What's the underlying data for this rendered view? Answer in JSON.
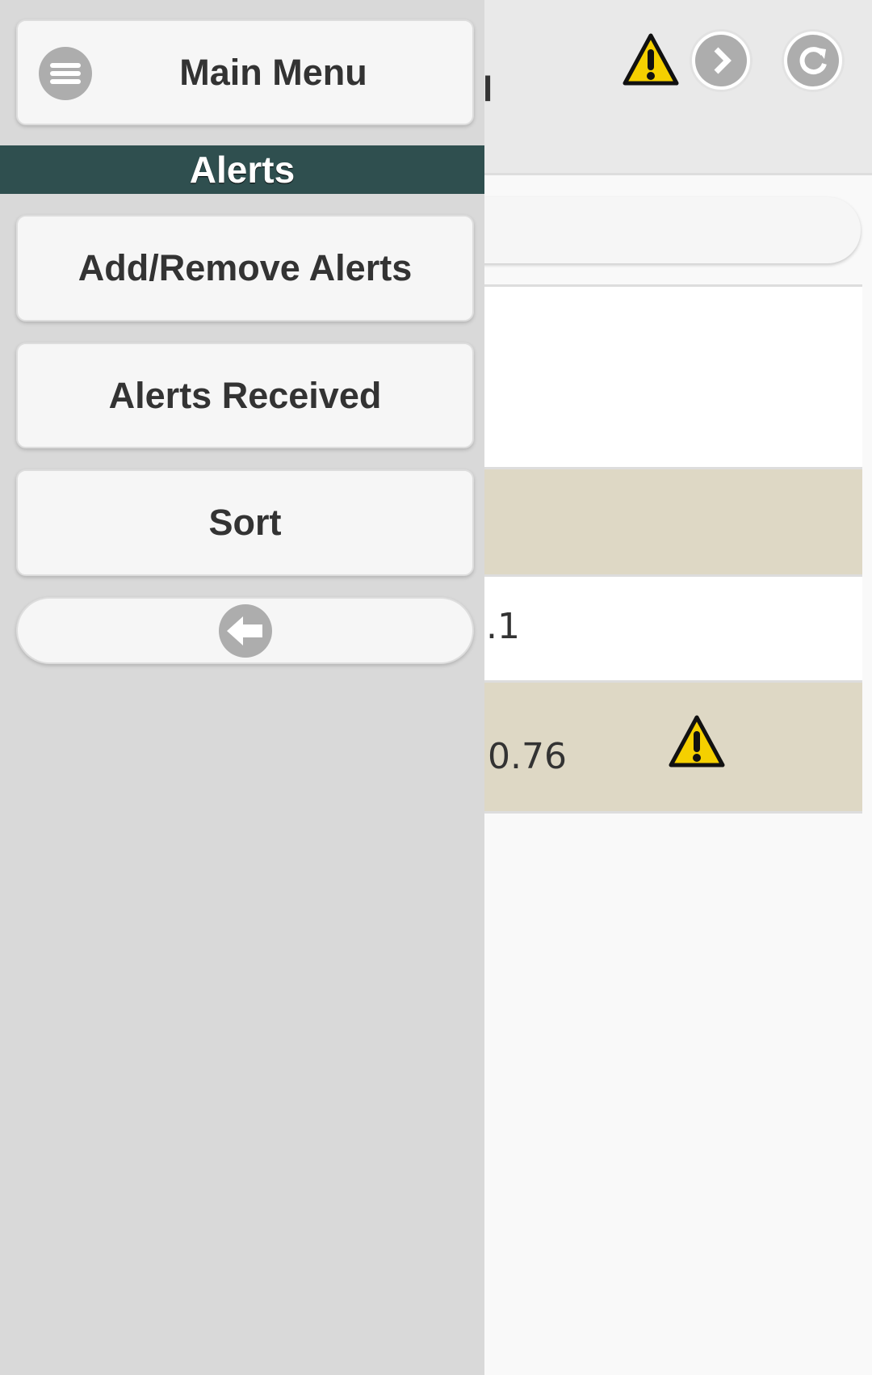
{
  "header": {
    "title_fragment": "l",
    "icons": [
      "warning-icon",
      "forward-icon",
      "refresh-icon"
    ]
  },
  "list": {
    "rows": [
      {
        "value": ""
      },
      {
        "value": ""
      },
      {
        "value": ".1"
      },
      {
        "value": "0.76",
        "icon": "warning-icon"
      }
    ]
  },
  "panel": {
    "main_menu_label": "Main Menu",
    "section_title": "Alerts",
    "items": [
      {
        "label": "Add/Remove Alerts"
      },
      {
        "label": "Alerts Received"
      },
      {
        "label": "Sort"
      }
    ],
    "back_icon": "arrow-left-icon"
  },
  "colors": {
    "section_bar": "#2f4f4f",
    "alt_row": "#ded8c5",
    "warning": "#f5d000",
    "icon_gray": "#adadad"
  }
}
